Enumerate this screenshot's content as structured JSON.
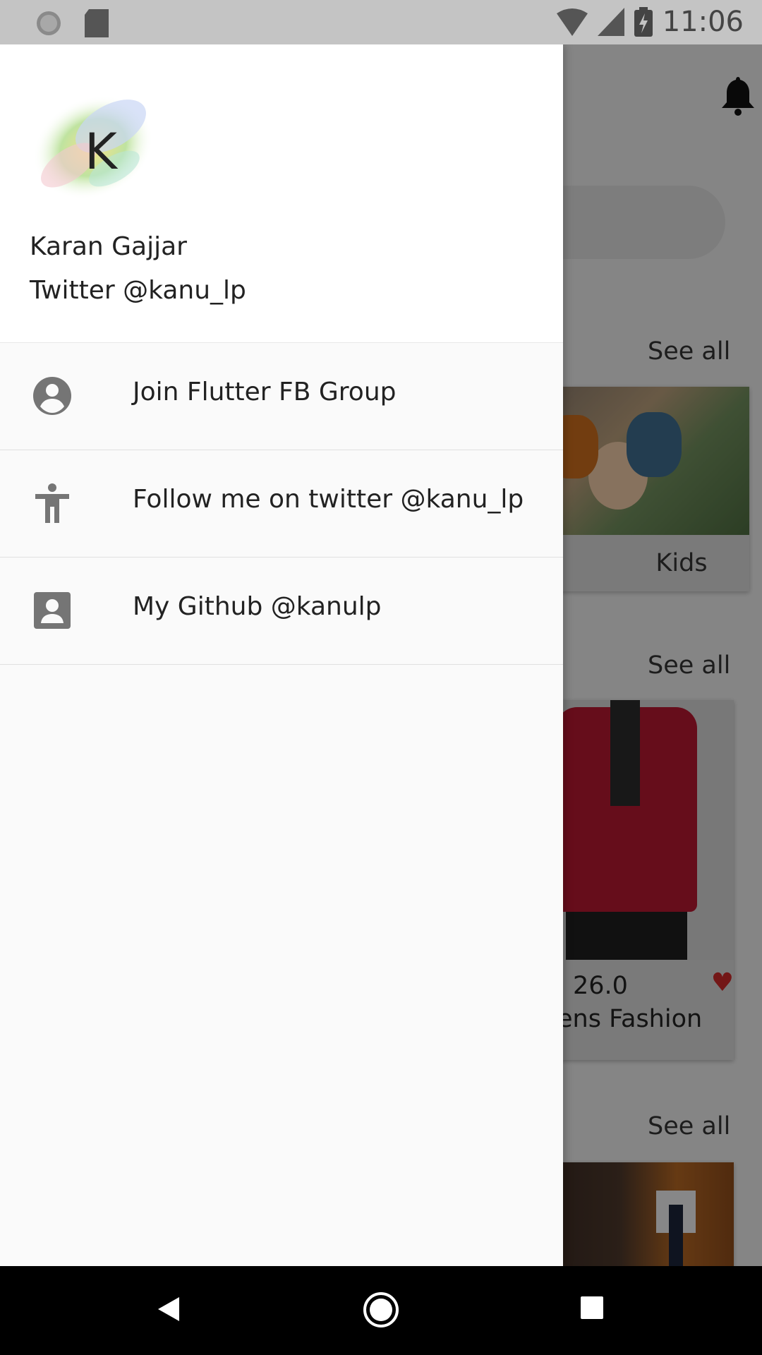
{
  "status_bar": {
    "time": "11:06"
  },
  "background": {
    "see_all_labels": [
      "See all",
      "See all",
      "See all"
    ],
    "kids_label": "Kids",
    "price": "26.0",
    "category": "ens Fashion"
  },
  "drawer": {
    "user": {
      "avatar_letter": "K",
      "name": "Karan Gajjar",
      "twitter": "Twitter @kanu_lp"
    },
    "items": [
      {
        "label": "Join Flutter FB Group",
        "icon": "account-circle-icon"
      },
      {
        "label": "Follow me on twitter @kanu_lp",
        "icon": "accessibility-icon"
      },
      {
        "label": "My Github @kanulp",
        "icon": "contact-box-icon"
      }
    ]
  }
}
